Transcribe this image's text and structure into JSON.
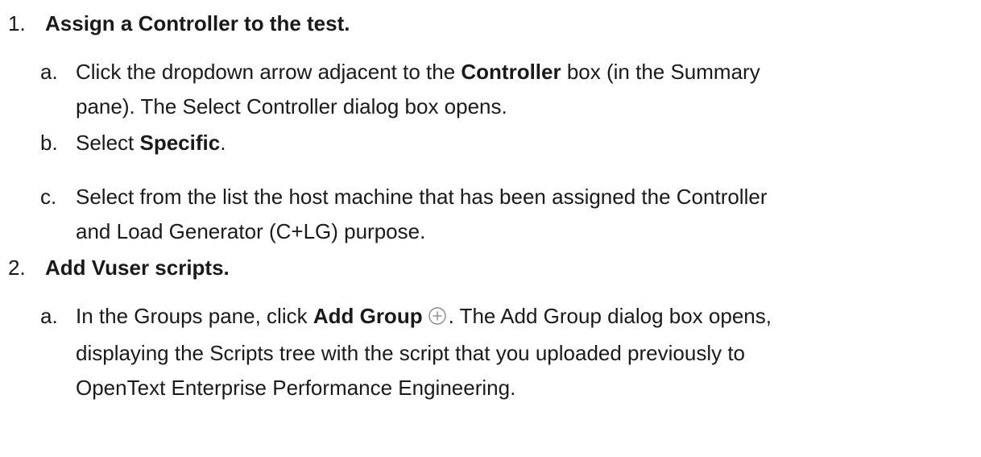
{
  "steps": [
    {
      "number": "1.",
      "title": "Assign a Controller to the test.",
      "substeps": [
        {
          "letter": "a.",
          "pre": "Click the dropdown arrow adjacent to the ",
          "bold": "Controller",
          "post": " box (in the Summary",
          "line2": "pane). The Select Controller dialog box opens."
        },
        {
          "letter": "b.",
          "pre": "Select ",
          "bold": "Specific",
          "post": "."
        },
        {
          "letter": "c.",
          "line1": "Select from the list the host machine that has been assigned the Controller",
          "line2": "and Load Generator (C+LG) purpose."
        }
      ]
    },
    {
      "number": "2.",
      "title": "Add Vuser scripts.",
      "substeps": [
        {
          "letter": "a.",
          "pre": "In the Groups pane, click ",
          "bold": "Add Group",
          "icon": "add-circle-icon",
          "post": ". The Add Group dialog box opens,",
          "line2": "displaying the Scripts tree with the script that you uploaded previously to",
          "line3": "OpenText Enterprise Performance Engineering."
        }
      ]
    }
  ],
  "colors": {
    "text": "#1a1a1a",
    "icon": "#8a8a8a"
  }
}
